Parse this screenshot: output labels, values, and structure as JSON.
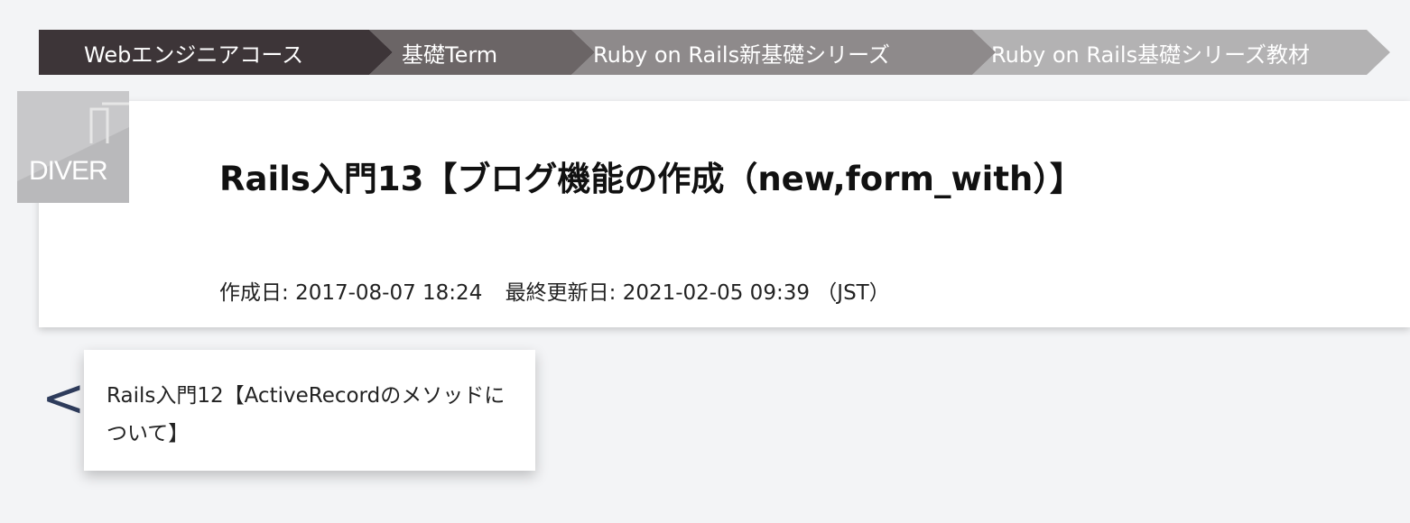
{
  "breadcrumb": [
    {
      "label": "Webエンジニアコース"
    },
    {
      "label": "基礎Term"
    },
    {
      "label": "Ruby on Rails新基礎シリーズ"
    },
    {
      "label": "Ruby on Rails基礎シリーズ教材"
    }
  ],
  "logo": {
    "text": "DIVER"
  },
  "article": {
    "title": "Rails入門13【ブログ機能の作成（new,form_with）】",
    "created_label": "作成日:",
    "created": "2017-08-07 18:24",
    "updated_label": "最終更新日:",
    "updated": "2021-02-05 09:39",
    "timezone": "（JST）"
  },
  "prev": {
    "arrow": "<",
    "title": "Rails入門12【ActiveRecordのメソッドについて】"
  },
  "colors": {
    "crumb1": "#3d3538",
    "crumb2": "#6b6566",
    "crumb3": "#8e8a8b",
    "crumb4": "#b3b2b3",
    "arrow": "#2e3c5c"
  }
}
